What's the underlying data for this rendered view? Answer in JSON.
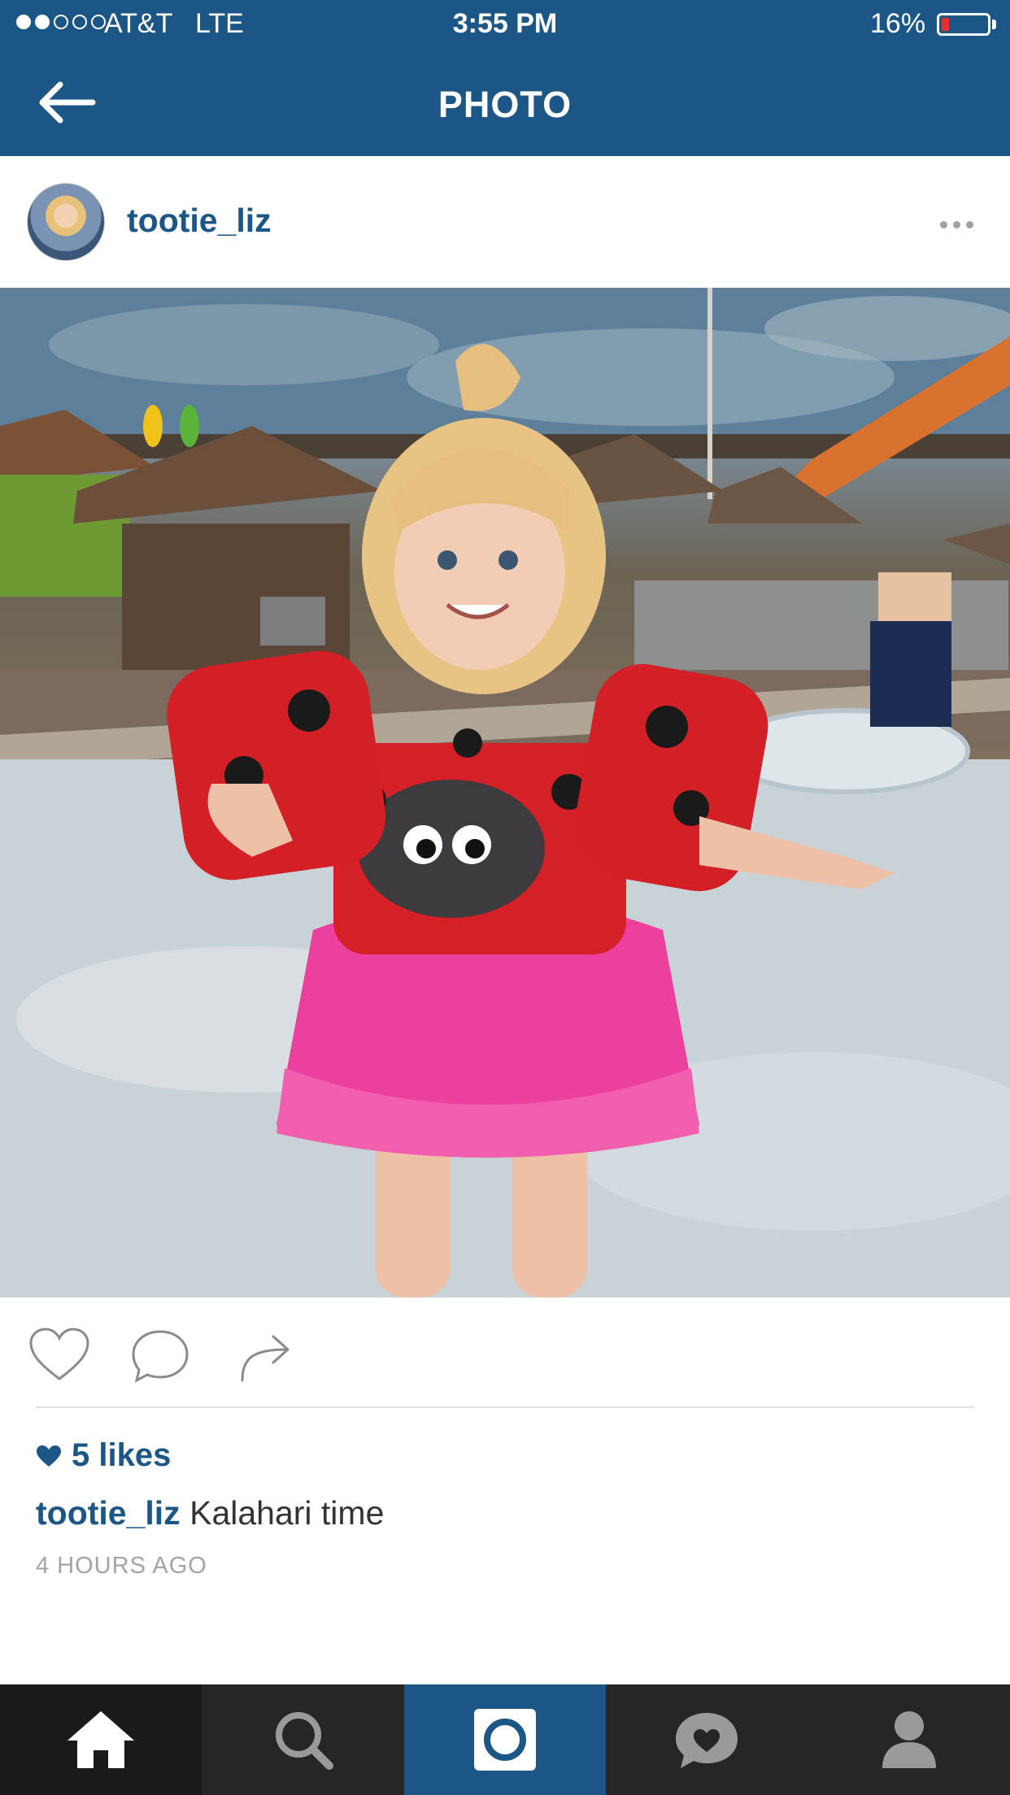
{
  "status_bar": {
    "carrier": "AT&T",
    "network": "LTE",
    "time": "3:55 PM",
    "battery": "16%",
    "battery_level": 0.16,
    "signal_bars": 2,
    "signal_total": 5
  },
  "nav": {
    "title": "PHOTO",
    "back_icon": "arrow-left-icon"
  },
  "post": {
    "username": "tootie_liz",
    "likes": "5 likes",
    "caption_user": "tootie_liz",
    "caption_text": "Kalahari time",
    "timestamp": "4 HOURS AGO"
  },
  "actions": {
    "icons": [
      "heart-icon",
      "comment-icon",
      "share-icon"
    ]
  },
  "tabbar": {
    "tabs": [
      "home-icon",
      "search-icon",
      "camera-icon",
      "activity-icon",
      "profile-icon"
    ],
    "active": "home"
  },
  "colors": {
    "brand": "#1b5687",
    "tabbar": "#262626",
    "active_tab": "#1b5687"
  }
}
